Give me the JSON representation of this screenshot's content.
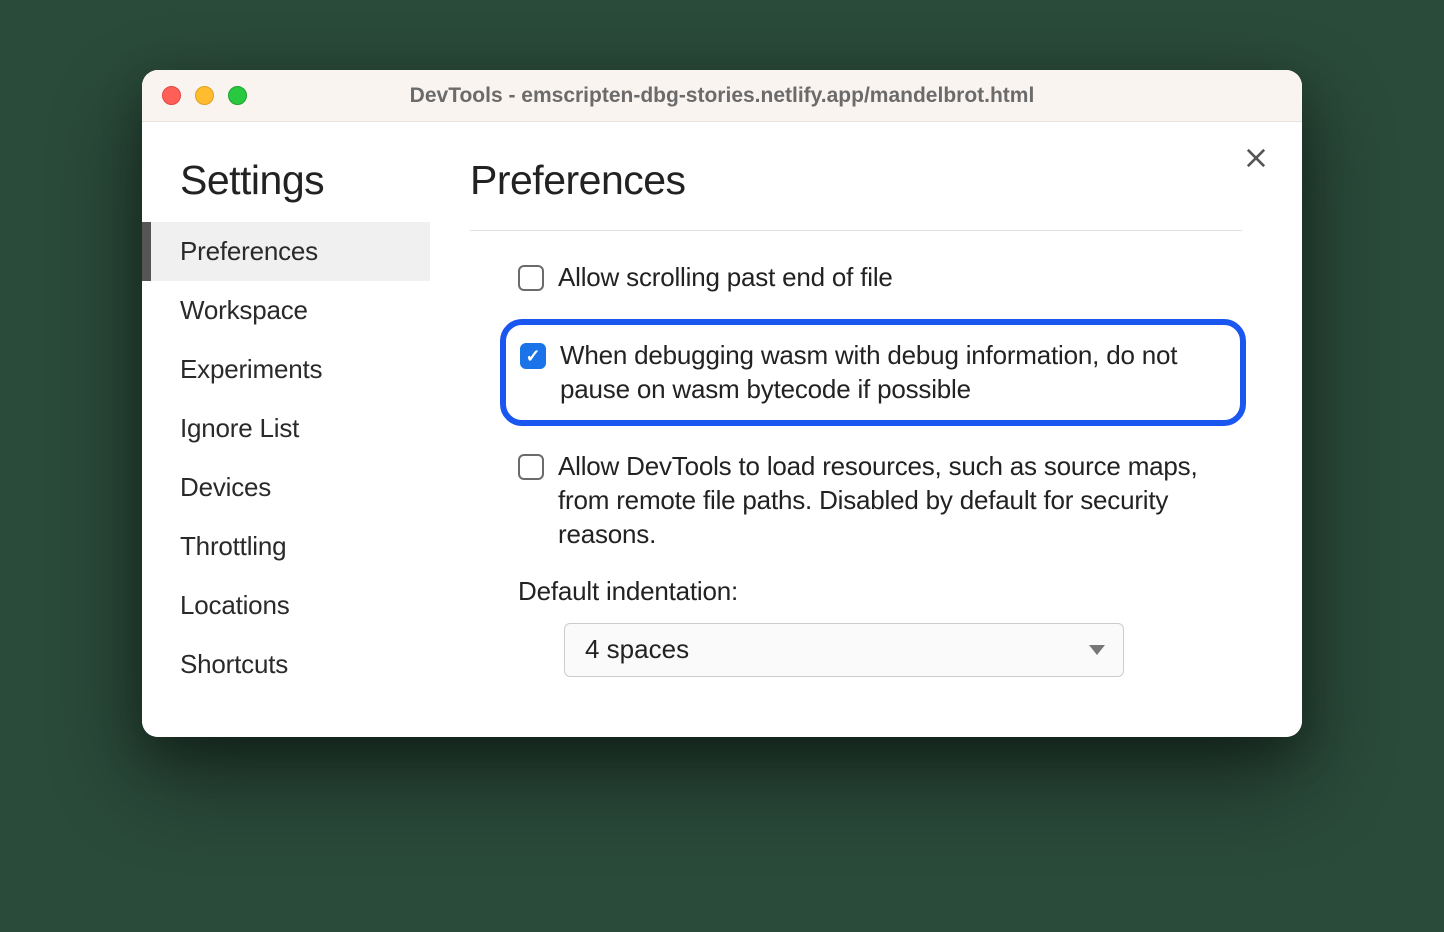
{
  "window": {
    "title": "DevTools - emscripten-dbg-stories.netlify.app/mandelbrot.html"
  },
  "sidebar": {
    "title": "Settings",
    "items": [
      {
        "label": "Preferences",
        "active": true
      },
      {
        "label": "Workspace",
        "active": false
      },
      {
        "label": "Experiments",
        "active": false
      },
      {
        "label": "Ignore List",
        "active": false
      },
      {
        "label": "Devices",
        "active": false
      },
      {
        "label": "Throttling",
        "active": false
      },
      {
        "label": "Locations",
        "active": false
      },
      {
        "label": "Shortcuts",
        "active": false
      }
    ]
  },
  "main": {
    "title": "Preferences",
    "checks": [
      {
        "label": "Allow scrolling past end of file",
        "checked": false,
        "highlighted": false
      },
      {
        "label": "When debugging wasm with debug information, do not pause on wasm bytecode if possible",
        "checked": true,
        "highlighted": true
      },
      {
        "label": "Allow DevTools to load resources, such as source maps, from remote file paths. Disabled by default for security reasons.",
        "checked": false,
        "highlighted": false
      }
    ],
    "indent_label": "Default indentation:",
    "indent_value": "4 spaces"
  }
}
